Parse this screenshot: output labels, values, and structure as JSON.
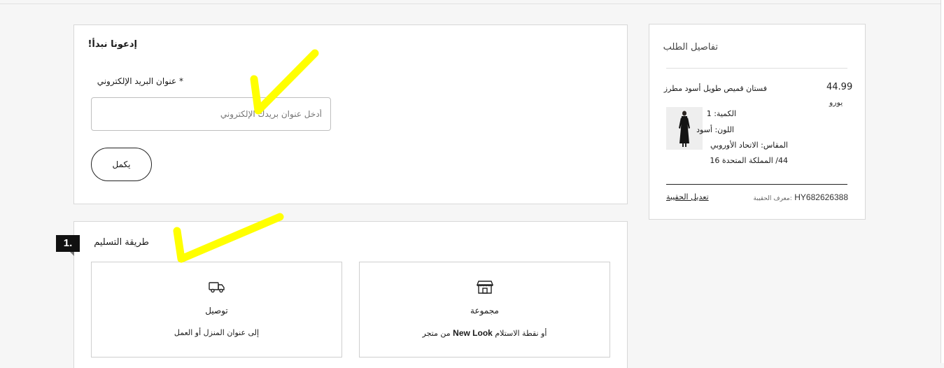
{
  "login": {
    "title": "إدعونا نبدأ!",
    "email_label": "* عنوان البريد الإلكتروني",
    "email_placeholder": "أدخل عنوان بريدك الإلكتروني",
    "email_value": "",
    "continue_label": "يكمل"
  },
  "delivery": {
    "step_number": "1.",
    "title": "طريقة التسليم",
    "options": [
      {
        "icon": "truck-icon",
        "title": "توصيل",
        "subtitle": "إلى عنوان المنزل أو العمل"
      },
      {
        "icon": "store-icon",
        "title": "مجموعة",
        "subtitle_pre": "أو نقطة الاستلام ",
        "subtitle_brand": "New Look",
        "subtitle_post": " من متجر"
      }
    ]
  },
  "summary": {
    "title": "تفاصيل الطلب",
    "product": {
      "name": "فستان قميص طويل أسود مطرز",
      "price": "44.99",
      "currency": "يورو",
      "quantity": "الكمية: 1",
      "color": "اللون: أسود",
      "size_line1": "المقاس: الاتحاد الأوروبي",
      "size_line2": "44/ المملكة المتحدة 16"
    },
    "edit_bag": "تعديل الحقيبة",
    "bag_id_label": "معرف الحقيبة:",
    "bag_id_value": "HY682626388"
  },
  "colors": {
    "background": "#f6f6f6",
    "highlighter": "#ffff00",
    "badge": "#111111"
  }
}
